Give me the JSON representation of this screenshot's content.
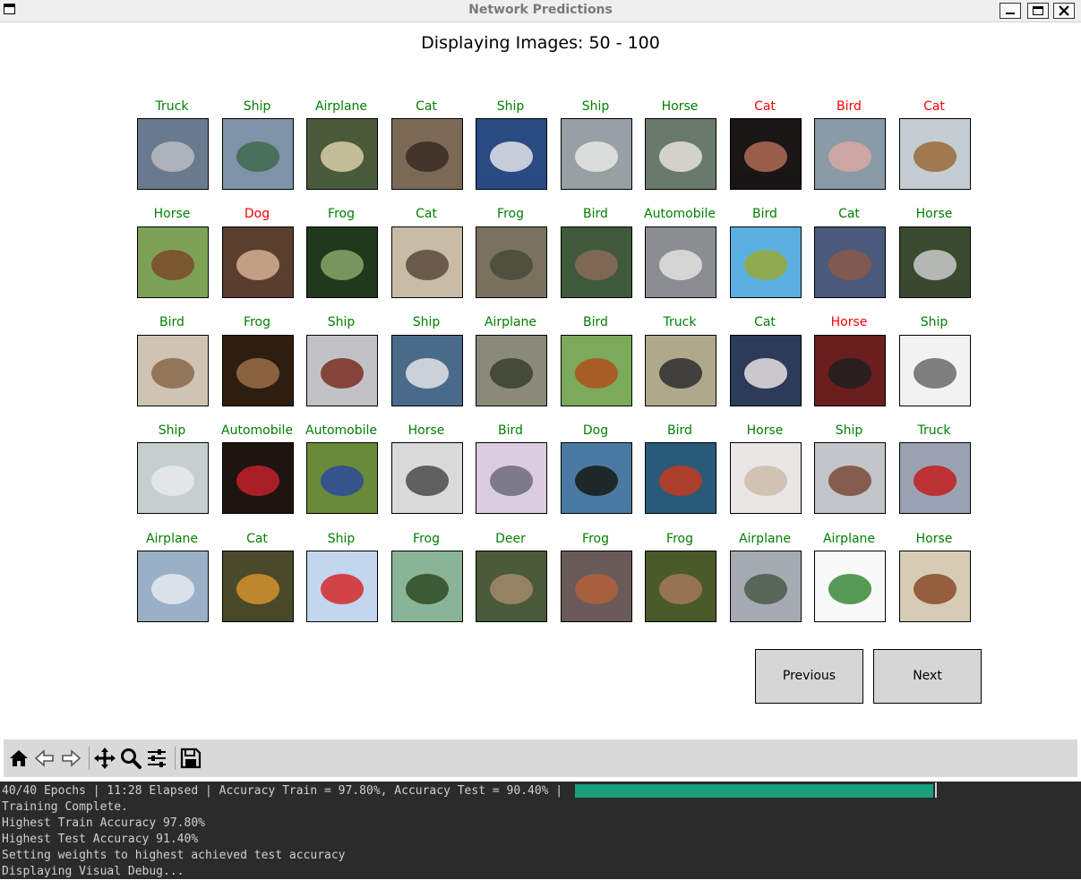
{
  "window": {
    "title": "Network Predictions"
  },
  "figure": {
    "title": "Displaying Images: 50 - 100"
  },
  "colors": {
    "correct": "#008000",
    "wrong": "#ff0000",
    "progress": "#19a07a"
  },
  "grid": [
    [
      {
        "label": "Truck",
        "correct": true,
        "bg": "#6a7a8e",
        "fg": "#b9bcc0"
      },
      {
        "label": "Ship",
        "correct": true,
        "bg": "#7f94a8",
        "fg": "#3f6a4f"
      },
      {
        "label": "Airplane",
        "correct": true,
        "bg": "#4a5a3a",
        "fg": "#d8cfa8"
      },
      {
        "label": "Cat",
        "correct": true,
        "bg": "#7a6a55",
        "fg": "#3a2a22"
      },
      {
        "label": "Ship",
        "correct": true,
        "bg": "#2a4a82",
        "fg": "#e0e4ea"
      },
      {
        "label": "Ship",
        "correct": true,
        "bg": "#97a0a4",
        "fg": "#e6e6e6"
      },
      {
        "label": "Horse",
        "correct": true,
        "bg": "#6a7a6a",
        "fg": "#e4e0dc"
      },
      {
        "label": "Cat",
        "correct": false,
        "bg": "#1a1616",
        "fg": "#b06a55"
      },
      {
        "label": "Bird",
        "correct": false,
        "bg": "#8a9aa6",
        "fg": "#d7a8a2"
      },
      {
        "label": "Cat",
        "correct": false,
        "bg": "#c4ccd4",
        "fg": "#9a6a3a"
      }
    ],
    [
      {
        "label": "Horse",
        "correct": true,
        "bg": "#7da255",
        "fg": "#7a4a2a"
      },
      {
        "label": "Dog",
        "correct": false,
        "bg": "#5a3e2e",
        "fg": "#d4b092"
      },
      {
        "label": "Frog",
        "correct": true,
        "bg": "#1e3a1a",
        "fg": "#8aa66a"
      },
      {
        "label": "Cat",
        "correct": true,
        "bg": "#c8bca6",
        "fg": "#5a4a3a"
      },
      {
        "label": "Frog",
        "correct": true,
        "bg": "#7a725e",
        "fg": "#4a4a3a"
      },
      {
        "label": "Bird",
        "correct": true,
        "bg": "#3e5a3a",
        "fg": "#8a6a5a"
      },
      {
        "label": "Automobile",
        "correct": true,
        "bg": "#8a8e92",
        "fg": "#e2e2e2"
      },
      {
        "label": "Bird",
        "correct": true,
        "bg": "#5ab0e0",
        "fg": "#9aa83a"
      },
      {
        "label": "Cat",
        "correct": true,
        "bg": "#4a5a7a",
        "fg": "#8a5a4a"
      },
      {
        "label": "Horse",
        "correct": true,
        "bg": "#3a4a2e",
        "fg": "#cacaca"
      }
    ],
    [
      {
        "label": "Bird",
        "correct": true,
        "bg": "#cfc4b4",
        "fg": "#8a6a4a"
      },
      {
        "label": "Frog",
        "correct": true,
        "bg": "#2e1e12",
        "fg": "#9a6e48"
      },
      {
        "label": "Ship",
        "correct": true,
        "bg": "#c2c2c6",
        "fg": "#7a2e22"
      },
      {
        "label": "Ship",
        "correct": true,
        "bg": "#4a6a8a",
        "fg": "#e2e2e6"
      },
      {
        "label": "Airplane",
        "correct": true,
        "bg": "#8a8a7a",
        "fg": "#3a3e2e"
      },
      {
        "label": "Bird",
        "correct": true,
        "bg": "#7aaa5a",
        "fg": "#b0501e"
      },
      {
        "label": "Truck",
        "correct": true,
        "bg": "#b0a88a",
        "fg": "#2e2e2e"
      },
      {
        "label": "Cat",
        "correct": true,
        "bg": "#2e3a5a",
        "fg": "#e6e2e2"
      },
      {
        "label": "Horse",
        "correct": false,
        "bg": "#6a1e1e",
        "fg": "#1e1e1e"
      },
      {
        "label": "Ship",
        "correct": true,
        "bg": "#f2f2f2",
        "fg": "#6a6a6a"
      }
    ],
    [
      {
        "label": "Ship",
        "correct": true,
        "bg": "#c6cece",
        "fg": "#e8eaea"
      },
      {
        "label": "Automobile",
        "correct": true,
        "bg": "#1e1410",
        "fg": "#c2202a"
      },
      {
        "label": "Automobile",
        "correct": true,
        "bg": "#6a8a3a",
        "fg": "#2a4a9a"
      },
      {
        "label": "Horse",
        "correct": true,
        "bg": "#dadada",
        "fg": "#4a4a4a"
      },
      {
        "label": "Bird",
        "correct": true,
        "bg": "#dccce0",
        "fg": "#6a6a7a"
      },
      {
        "label": "Dog",
        "correct": true,
        "bg": "#4a7aa2",
        "fg": "#161a16"
      },
      {
        "label": "Bird",
        "correct": true,
        "bg": "#2a5a7a",
        "fg": "#c23a1e"
      },
      {
        "label": "Horse",
        "correct": true,
        "bg": "#eae6e6",
        "fg": "#ccbcaa"
      },
      {
        "label": "Ship",
        "correct": true,
        "bg": "#c2c6ca",
        "fg": "#7a4a3a"
      },
      {
        "label": "Truck",
        "correct": true,
        "bg": "#9aa2b2",
        "fg": "#c21e1e"
      }
    ],
    [
      {
        "label": "Airplane",
        "correct": true,
        "bg": "#9ab0c6",
        "fg": "#e6eaee"
      },
      {
        "label": "Cat",
        "correct": true,
        "bg": "#4a4a2a",
        "fg": "#d2922e"
      },
      {
        "label": "Ship",
        "correct": true,
        "bg": "#c2d6ee",
        "fg": "#d22a2a"
      },
      {
        "label": "Frog",
        "correct": true,
        "bg": "#8ab496",
        "fg": "#2e4a22"
      },
      {
        "label": "Deer",
        "correct": true,
        "bg": "#4a5a3a",
        "fg": "#a28a6a"
      },
      {
        "label": "Frog",
        "correct": true,
        "bg": "#6a5a5a",
        "fg": "#b2603a"
      },
      {
        "label": "Frog",
        "correct": true,
        "bg": "#4a5a2a",
        "fg": "#a2785a"
      },
      {
        "label": "Airplane",
        "correct": true,
        "bg": "#a6aab2",
        "fg": "#4a5a4a"
      },
      {
        "label": "Airplane",
        "correct": true,
        "bg": "#f8f8f8",
        "fg": "#3a8a3a"
      },
      {
        "label": "Horse",
        "correct": true,
        "bg": "#d6ccb6",
        "fg": "#8a4a2a"
      }
    ]
  ],
  "buttons": {
    "previous": "Previous",
    "next": "Next"
  },
  "toolbar": {
    "icons": [
      "home-icon",
      "back-icon",
      "forward-icon",
      "pan-icon",
      "zoom-icon",
      "configure-icon",
      "save-icon"
    ]
  },
  "terminal": {
    "status": "40/40 Epochs | 11:28 Elapsed | Accuracy Train = 97.80%, Accuracy Test = 90.40% |",
    "progress_fraction": 1.0,
    "lines": [
      "Training Complete.",
      "Highest Train Accuracy 97.80%",
      "Highest Test Accuracy 91.40%",
      "Setting weights to highest achieved test accuracy",
      "Displaying Visual Debug..."
    ]
  }
}
